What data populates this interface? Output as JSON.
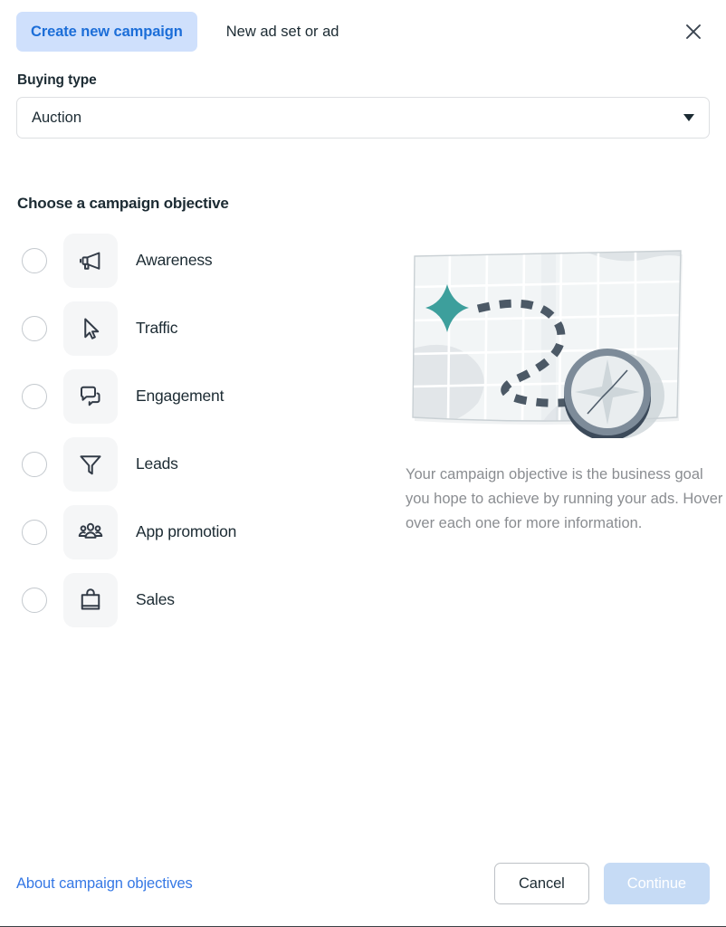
{
  "header": {
    "tabs": [
      {
        "label": "Create new campaign",
        "active": true
      },
      {
        "label": "New ad set or ad",
        "active": false
      }
    ],
    "close_icon": "close-icon"
  },
  "buying_type": {
    "label": "Buying type",
    "value": "Auction",
    "caret_icon": "chevron-down-icon"
  },
  "objectives_section": {
    "title": "Choose a campaign objective",
    "items": [
      {
        "label": "Awareness",
        "icon": "megaphone-icon",
        "selected": false
      },
      {
        "label": "Traffic",
        "icon": "cursor-arrow-icon",
        "selected": false
      },
      {
        "label": "Engagement",
        "icon": "speech-bubbles-icon",
        "selected": false
      },
      {
        "label": "Leads",
        "icon": "funnel-icon",
        "selected": false
      },
      {
        "label": "App promotion",
        "icon": "people-group-icon",
        "selected": false
      },
      {
        "label": "Sales",
        "icon": "shopping-bag-icon",
        "selected": false
      }
    ]
  },
  "info_panel": {
    "illustration": "map-compass-illustration",
    "description": "Your campaign objective is the business goal you hope to achieve by running your ads. Hover over each one for more information."
  },
  "footer": {
    "about_link": "About campaign objectives",
    "cancel_label": "Cancel",
    "continue_label": "Continue",
    "continue_disabled": true
  },
  "colors": {
    "tab_active_bg": "#cfe0fc",
    "tab_active_text": "#1c6ed8",
    "link_blue": "#3578e5",
    "continue_disabled_bg": "#c6dbf5",
    "text_primary": "#1c2b33",
    "text_muted": "#8a8d91",
    "tile_bg": "#f5f6f7",
    "border": "#dddfe2",
    "illustration_teal": "#3d9f9c",
    "illustration_slate": "#4c5966"
  }
}
